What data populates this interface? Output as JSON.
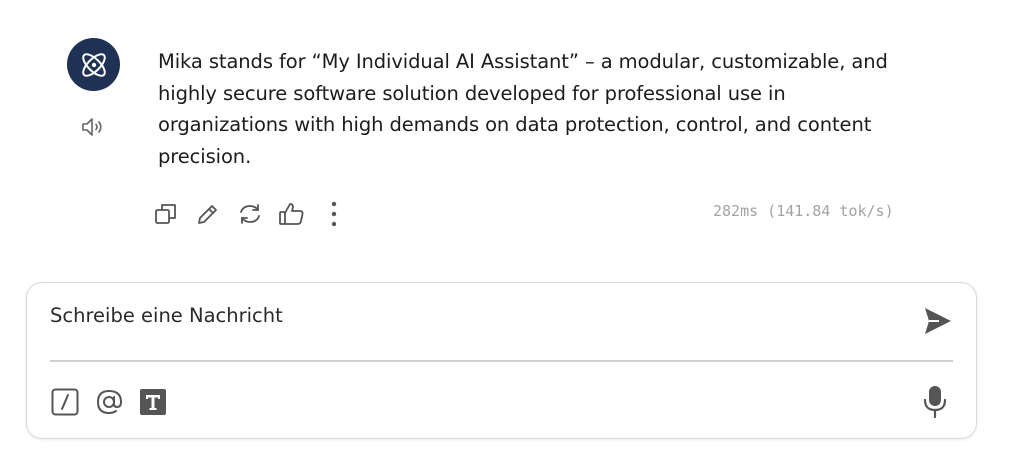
{
  "message": {
    "text": "Mika stands for “My Individual AI Assistant” – a modular, customizable, and highly secure software solution developed for professional use in organizations with high demands on data protection, control, and content precision.",
    "stats": "282ms (141.84 tok/s)"
  },
  "icons": {
    "avatar": "atom-icon",
    "speaker": "speaker-icon",
    "actions": [
      "copy-icon",
      "edit-icon",
      "regenerate-icon",
      "thumbs-up-icon",
      "more-vertical-icon"
    ],
    "tools": [
      "slash-command-icon",
      "mention-icon",
      "text-format-icon"
    ],
    "send": "send-icon",
    "mic": "microphone-icon"
  },
  "composer": {
    "placeholder": "Schreibe eine Nachricht"
  },
  "colors": {
    "avatar_bg": "#1f3155",
    "icon": "#555555",
    "stats": "#a3a3a3"
  }
}
